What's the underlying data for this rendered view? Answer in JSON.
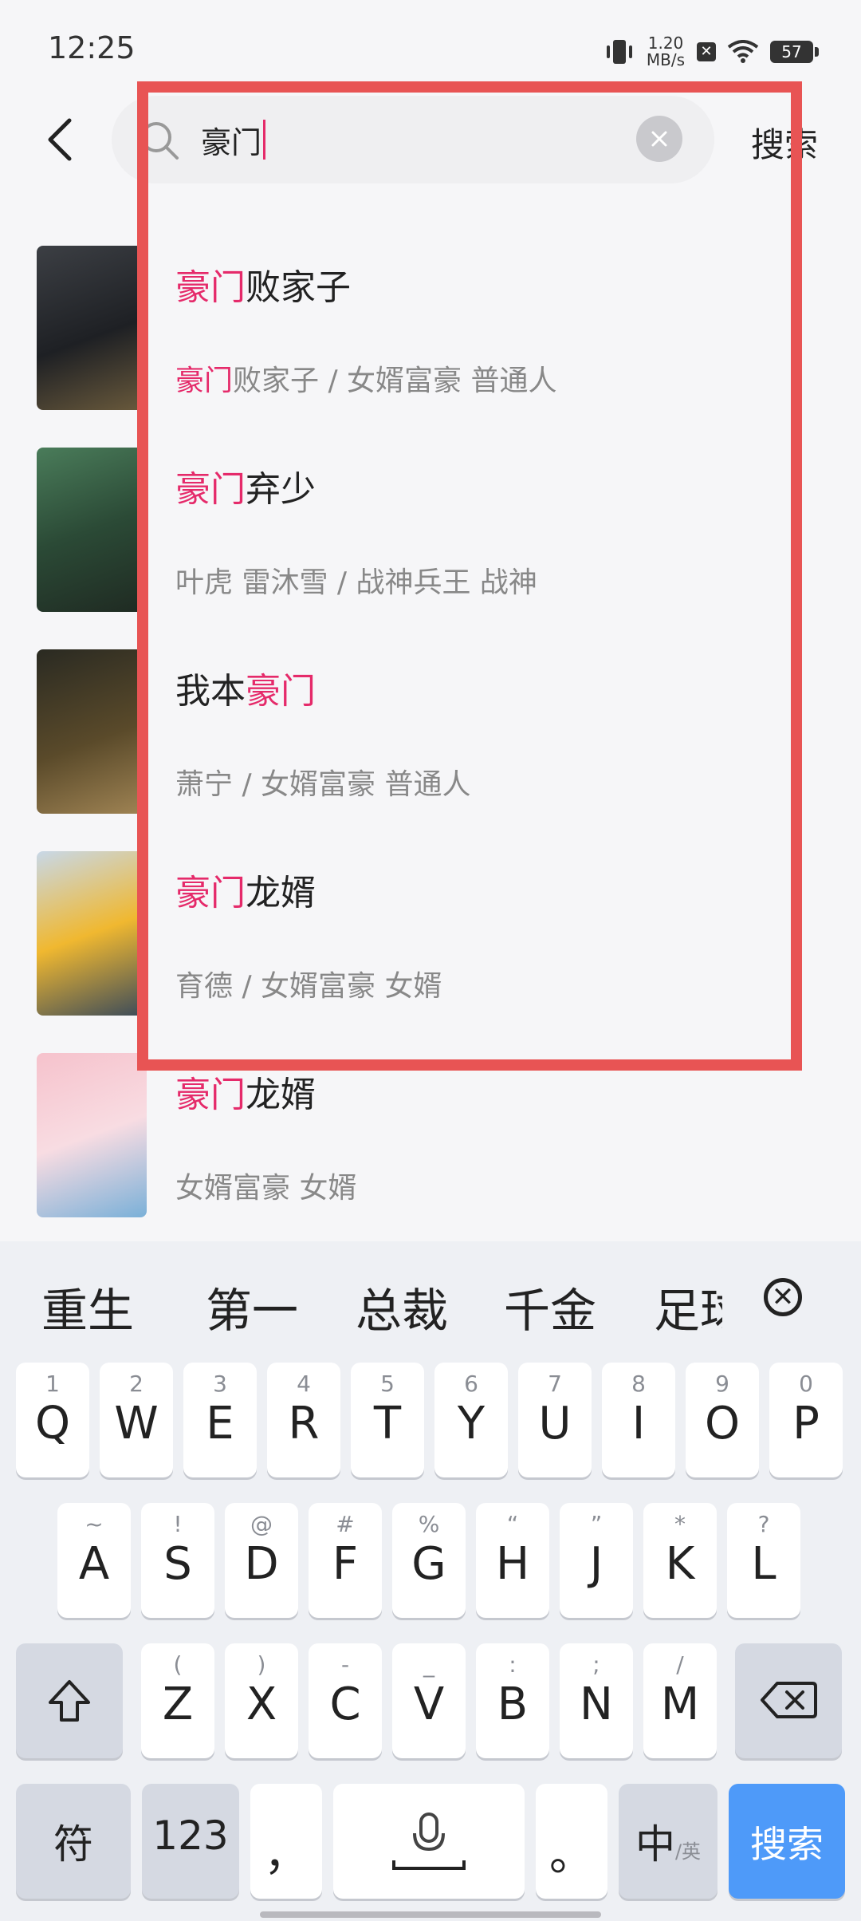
{
  "status_bar": {
    "time": "12:25",
    "net_speed": "1.20 MB/s",
    "battery": "57"
  },
  "search": {
    "query": "豪门",
    "submit_label": "搜索"
  },
  "results": [
    {
      "title_prefix": "",
      "title_highlight": "豪门",
      "title_rest": "败家子",
      "sub_highlight": "豪门",
      "sub_rest": "败家子 / 女婿富豪 普通人"
    },
    {
      "title_prefix": "",
      "title_highlight": "豪门",
      "title_rest": "弃少",
      "sub_highlight": "",
      "sub_rest": "叶虎 雷沐雪 / 战神兵王 战神"
    },
    {
      "title_prefix": "我本",
      "title_highlight": "豪门",
      "title_rest": "",
      "sub_highlight": "",
      "sub_rest": "萧宁 / 女婿富豪 普通人"
    },
    {
      "title_prefix": "",
      "title_highlight": "豪门",
      "title_rest": "龙婿",
      "sub_highlight": "",
      "sub_rest": "育德 / 女婿富豪 女婿"
    },
    {
      "title_prefix": "",
      "title_highlight": "豪门",
      "title_rest": "龙婿",
      "sub_highlight": "",
      "sub_rest": "女婿富豪 女婿"
    }
  ],
  "keyboard": {
    "candidates": [
      "重生",
      "第一",
      "总裁",
      "千金",
      "足球"
    ],
    "row1": [
      {
        "hint": "1",
        "key": "Q"
      },
      {
        "hint": "2",
        "key": "W"
      },
      {
        "hint": "3",
        "key": "E"
      },
      {
        "hint": "4",
        "key": "R"
      },
      {
        "hint": "5",
        "key": "T"
      },
      {
        "hint": "6",
        "key": "Y"
      },
      {
        "hint": "7",
        "key": "U"
      },
      {
        "hint": "8",
        "key": "I"
      },
      {
        "hint": "9",
        "key": "O"
      },
      {
        "hint": "0",
        "key": "P"
      }
    ],
    "row2": [
      {
        "hint": "~",
        "key": "A"
      },
      {
        "hint": "!",
        "key": "S"
      },
      {
        "hint": "@",
        "key": "D"
      },
      {
        "hint": "#",
        "key": "F"
      },
      {
        "hint": "%",
        "key": "G"
      },
      {
        "hint": "“",
        "key": "H"
      },
      {
        "hint": "”",
        "key": "J"
      },
      {
        "hint": "*",
        "key": "K"
      },
      {
        "hint": "?",
        "key": "L"
      }
    ],
    "row3": [
      {
        "hint": "(",
        "key": "Z"
      },
      {
        "hint": ")",
        "key": "X"
      },
      {
        "hint": "-",
        "key": "C"
      },
      {
        "hint": "_",
        "key": "V"
      },
      {
        "hint": ":",
        "key": "B"
      },
      {
        "hint": ";",
        "key": "N"
      },
      {
        "hint": "/",
        "key": "M"
      }
    ],
    "symbols_label": "符",
    "numbers_label": "123",
    "comma": "，",
    "period": "。",
    "lang_main": "中",
    "lang_alt": "/英",
    "search_key_label": "搜索"
  },
  "colors": {
    "highlight": "#e52a6a",
    "annotation_box": "#e85454",
    "search_key": "#4e9af9"
  }
}
